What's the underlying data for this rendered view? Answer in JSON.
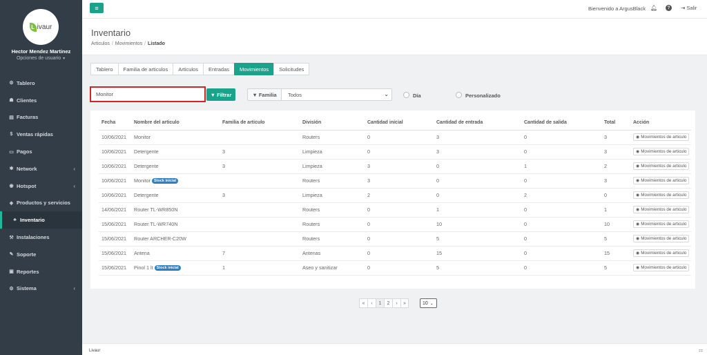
{
  "brand": {
    "logo_text": "ivaur",
    "logo_letter": "L"
  },
  "user": {
    "name": "Hector Mendez Martinez",
    "options": "Opciones de usuario"
  },
  "sidebar": {
    "items": [
      {
        "icon": "⚙",
        "label": "Tablero"
      },
      {
        "icon": "☗",
        "label": "Clientes"
      },
      {
        "icon": "▤",
        "label": "Facturas"
      },
      {
        "icon": "$",
        "label": "Ventas rápidas"
      },
      {
        "icon": "▭",
        "label": "Pagos"
      },
      {
        "icon": "✱",
        "label": "Network",
        "chevron": "‹"
      },
      {
        "icon": "◉",
        "label": "Hotspot",
        "chevron": "‹"
      },
      {
        "icon": "◈",
        "label": "Productos y servicios"
      },
      {
        "icon": "♣",
        "label": "Inventario"
      },
      {
        "icon": "⚒",
        "label": "Instalaciones"
      },
      {
        "icon": "✎",
        "label": "Soporte"
      },
      {
        "icon": "▣",
        "label": "Reportes"
      },
      {
        "icon": "⚙",
        "label": "Sistema",
        "chevron": "‹"
      }
    ]
  },
  "topbar": {
    "welcome": "Bienvenido a ArgusBlack",
    "logout": "Salir",
    "help": "?"
  },
  "page": {
    "title": "Inventario",
    "breadcrumb": [
      "Articulos",
      "Movimientos",
      "Listado"
    ]
  },
  "tabs": [
    "Tablero",
    "Familia de articulos",
    "Articulos",
    "Entradas",
    "Movimientos",
    "Solicitudes"
  ],
  "filters": {
    "search_value": "Monitor",
    "filter_button": "Filtrar",
    "family_label": "Familia",
    "family_value": "Todos",
    "radio_day": "Día",
    "radio_custom": "Personalizado"
  },
  "table": {
    "headers": [
      "Fecha",
      "Nombre del articulo",
      "Familia de articulo",
      "División",
      "Cantidad inicial",
      "Cantidad de entrada",
      "Cantidad de salida",
      "Total",
      "Acción"
    ],
    "action_label": "Movimientos de articulo",
    "rows": [
      {
        "fecha": "10/06/2021",
        "nombre": "Monitor",
        "badge": "",
        "familia": "",
        "division": "Routers",
        "inicial": "0",
        "entrada": "3",
        "salida": "0",
        "total": "3"
      },
      {
        "fecha": "10/06/2021",
        "nombre": "Detergente",
        "badge": "",
        "familia": "3",
        "division": "Limpieza",
        "inicial": "0",
        "entrada": "3",
        "salida": "0",
        "total": "3"
      },
      {
        "fecha": "10/06/2021",
        "nombre": "Detergente",
        "badge": "",
        "familia": "3",
        "division": "Limpieza",
        "inicial": "3",
        "entrada": "0",
        "salida": "1",
        "total": "2"
      },
      {
        "fecha": "10/06/2021",
        "nombre": "Monitor",
        "badge": "Stock inicial",
        "familia": "",
        "division": "Routers",
        "inicial": "3",
        "entrada": "0",
        "salida": "0",
        "total": "3"
      },
      {
        "fecha": "10/06/2021",
        "nombre": "Detergente",
        "badge": "",
        "familia": "3",
        "division": "Limpieza",
        "inicial": "2",
        "entrada": "0",
        "salida": "2",
        "total": "0"
      },
      {
        "fecha": "14/06/2021",
        "nombre": "Router TL-WR850N",
        "badge": "",
        "familia": "",
        "division": "Routers",
        "inicial": "0",
        "entrada": "1",
        "salida": "0",
        "total": "1"
      },
      {
        "fecha": "15/06/2021",
        "nombre": "Router TL-WR740N",
        "badge": "",
        "familia": "",
        "division": "Routers",
        "inicial": "0",
        "entrada": "10",
        "salida": "0",
        "total": "10"
      },
      {
        "fecha": "15/06/2021",
        "nombre": "Router ARCHER-C20W",
        "badge": "",
        "familia": "",
        "division": "Routers",
        "inicial": "0",
        "entrada": "5",
        "salida": "0",
        "total": "5"
      },
      {
        "fecha": "15/06/2021",
        "nombre": "Antena",
        "badge": "",
        "familia": "7",
        "division": "Antenas",
        "inicial": "0",
        "entrada": "15",
        "salida": "0",
        "total": "15"
      },
      {
        "fecha": "15/06/2021",
        "nombre": "Pinol 1 lt",
        "badge": "Stock inicial",
        "familia": "1",
        "division": "Aseo y sanitizar",
        "inicial": "0",
        "entrada": "5",
        "salida": "0",
        "total": "5"
      }
    ]
  },
  "pagination": {
    "first": "«",
    "prev": "‹",
    "pages": [
      "1",
      "2"
    ],
    "next": "›",
    "last": "»",
    "page_size": "10"
  },
  "footer": {
    "text": "Livaur"
  },
  "colors": {
    "accent": "#1aa38a",
    "sidebar_bg": "#323d47",
    "badge": "#2f7fc3",
    "highlight_border": "#d1232a"
  }
}
